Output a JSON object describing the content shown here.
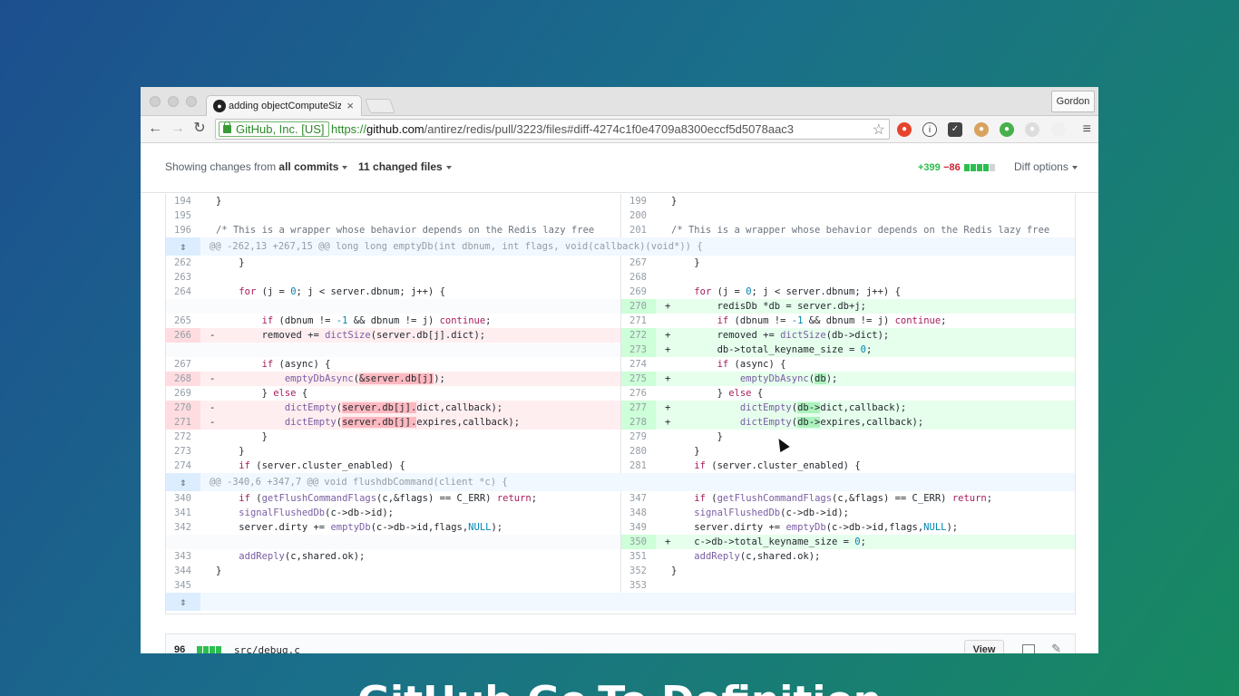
{
  "browser": {
    "tab_title": "adding objectComputeSize",
    "profile_name": "Gordon",
    "secure_label": "GitHub, Inc. [US]",
    "url_scheme": "https://",
    "url_host": "github.com",
    "url_path": "/antirez/redis/pull/3223/files#diff-4274c1f0e4709a8300eccf5d5078aac3"
  },
  "pr_bar": {
    "showing_prefix": "Showing changes from",
    "showing_value": "all commits",
    "changed_files": "11 changed files",
    "additions": "+399",
    "deletions": "−86",
    "diff_options": "Diff options"
  },
  "diff": {
    "hunk1": "@@ -262,13 +267,15 @@ long long emptyDb(int dbnum, int flags, void(callback)(void*)) {",
    "hunk2": "@@ -340,6 +347,7 @@ void flushdbCommand(client *c) {"
  },
  "next_file": {
    "stat": "96",
    "filename": "src/debug.c",
    "view_label": "View"
  },
  "caption": "GitHub Go-To Definition"
}
